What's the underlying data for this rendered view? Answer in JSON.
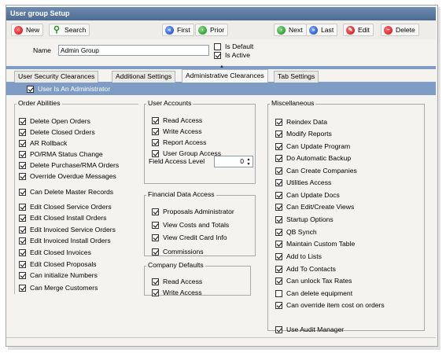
{
  "window": {
    "title": "User group Setup"
  },
  "toolbar": {
    "new": "New",
    "search": "Search",
    "first": "First",
    "prior": "Prior",
    "next": "Next",
    "last": "Last",
    "edit": "Edit",
    "delete": "Delete"
  },
  "form": {
    "name_label": "Name",
    "name_value": "Admin Group",
    "is_default_label": "Is Default",
    "is_default": false,
    "is_active_label": "Is Active",
    "is_active": true
  },
  "tabs": [
    {
      "label": "User Security Clearances",
      "active": false
    },
    {
      "label": "Additional Settings",
      "active": false
    },
    {
      "label": "Administrative Clearances",
      "active": true
    },
    {
      "label": "Tab Settings",
      "active": false
    }
  ],
  "admin": {
    "label": "User Is An Administrator",
    "checked": true
  },
  "order_abilities": {
    "title": "Order Abilities",
    "items": [
      {
        "label": "Delete Open Orders",
        "checked": true
      },
      {
        "label": "Delete Closed Orders",
        "checked": true
      },
      {
        "label": "AR Rollback",
        "checked": true
      },
      {
        "label": "PO/RMA Status Change",
        "checked": true
      },
      {
        "label": "Delete Purchase/RMA Orders",
        "checked": true
      },
      {
        "label": "Override Overdue Messages",
        "checked": true
      },
      {
        "label": "Can Delete Master Records",
        "checked": true
      },
      {
        "label": "Edit Closed Service Orders",
        "checked": true
      },
      {
        "label": "Edit Closed Install Orders",
        "checked": true
      },
      {
        "label": "Edit Invoiced Service Orders",
        "checked": true
      },
      {
        "label": "Edit Invoiced Install Orders",
        "checked": true
      },
      {
        "label": "Edit Closed Invoices",
        "checked": true
      },
      {
        "label": "Edit Closed Proposals",
        "checked": true
      },
      {
        "label": "Can initialize Numbers",
        "checked": true
      },
      {
        "label": "Can Merge Customers",
        "checked": true
      }
    ]
  },
  "user_accounts": {
    "title": "User Accounts",
    "items": [
      {
        "label": "Read Access",
        "checked": true
      },
      {
        "label": "Write Access",
        "checked": true
      },
      {
        "label": "Report Access",
        "checked": true
      },
      {
        "label": "User Group Access",
        "checked": true
      }
    ],
    "field_access_label": "Field Access Level",
    "field_access_value": "0"
  },
  "financial": {
    "title": "Financial Data Access",
    "items": [
      {
        "label": "Proposals Administrator",
        "checked": true
      },
      {
        "label": "View Costs and Totals",
        "checked": true
      },
      {
        "label": "View Credit Card Info",
        "checked": true
      },
      {
        "label": "Commissions",
        "checked": true
      }
    ]
  },
  "company_defaults": {
    "title": "Company Defaults",
    "items": [
      {
        "label": "Read Access",
        "checked": true
      },
      {
        "label": "Write Access",
        "checked": true
      }
    ]
  },
  "misc": {
    "title": "Miscellaneous",
    "items": [
      {
        "label": "Reindex Data",
        "checked": true
      },
      {
        "label": "Modify Reports",
        "checked": true
      },
      {
        "label": "Can Update Program",
        "checked": true
      },
      {
        "label": "Do Automatic Backup",
        "checked": true
      },
      {
        "label": "Can Create Companies",
        "checked": true
      },
      {
        "label": "Utilities Access",
        "checked": true
      },
      {
        "label": "Can Update Docs",
        "checked": true
      },
      {
        "label": "Can Edit/Create Views",
        "checked": true
      },
      {
        "label": "Startup Options",
        "checked": true
      },
      {
        "label": "QB Synch",
        "checked": true
      },
      {
        "label": "Maintain Custom Table",
        "checked": true
      },
      {
        "label": "Add to Lists",
        "checked": true
      },
      {
        "label": "Add To Contacts",
        "checked": true
      },
      {
        "label": "Can unlock Tax Rates",
        "checked": true
      },
      {
        "label": "Can delete equipment",
        "checked": false
      },
      {
        "label": "Can override item cost on orders",
        "checked": true
      },
      {
        "label": "Use Audit Manager",
        "checked": true
      }
    ]
  },
  "icons": {
    "new": "new-record-icon",
    "search": "search-icon",
    "first": "first-record-icon",
    "prior": "prior-record-icon",
    "next": "next-record-icon",
    "last": "last-record-icon",
    "edit": "edit-icon",
    "delete": "delete-icon"
  },
  "colors": {
    "title_bar": "#5a77a0",
    "accent_bar": "#7f9cc4",
    "panel": "#f4f3ef"
  }
}
